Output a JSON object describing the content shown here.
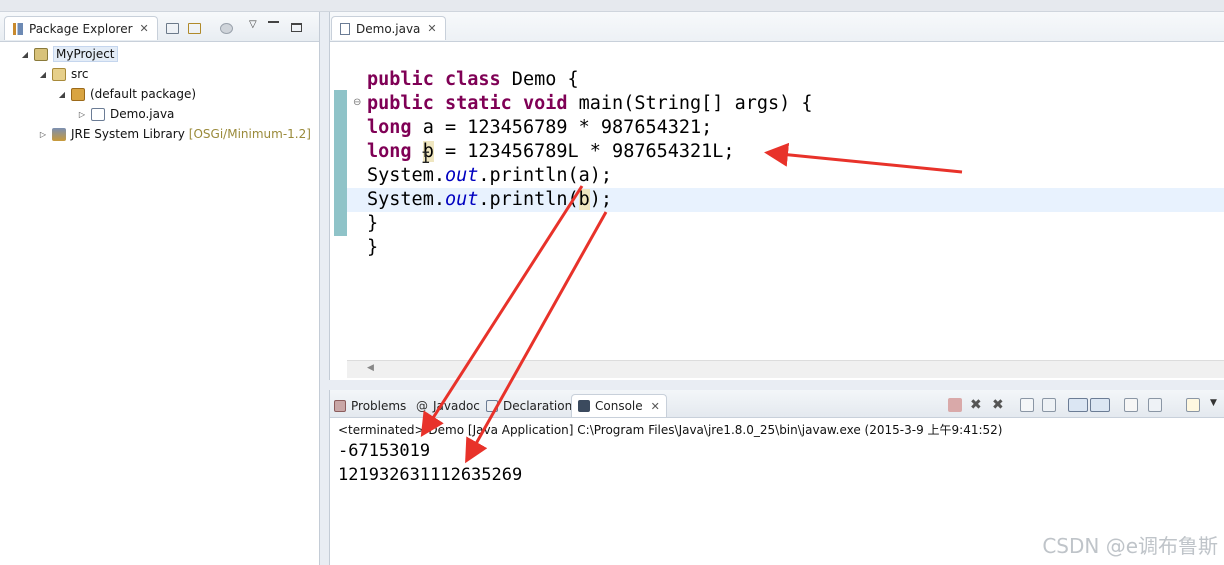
{
  "package_explorer": {
    "tab_label": "Package Explorer",
    "tree": [
      {
        "label": "MyProject"
      },
      {
        "label": "src"
      },
      {
        "label": "(default package)"
      },
      {
        "label": "Demo.java"
      },
      {
        "label": "JRE System Library",
        "decoration": "[OSGi/Minimum-1.2]"
      }
    ]
  },
  "editor": {
    "tab_label": "Demo.java",
    "code": {
      "line1_kw1": "public",
      "line1_kw2": "class",
      "line1_rest": " Demo {",
      "line2_kw1": "public",
      "line2_kw2": "static",
      "line2_kw3": "void",
      "line2_rest": " main(String[] args) {",
      "line3_kw": "long",
      "line3_rest": " a = 123456789 * 987654321;",
      "line4_kw": "long",
      "line4_var": "b",
      "line4_rest": " = 123456789L * 987654321L;",
      "line5_pre": "System.",
      "line5_fld": "out",
      "line5_post": ".println(a);",
      "line6_pre": "System.",
      "line6_fld": "out",
      "line6_post": ".println(",
      "line6_arg": "b",
      "line6_end": ");",
      "line7": "}",
      "line8": "}"
    }
  },
  "console": {
    "tabs": {
      "problems": "Problems",
      "javadoc": "Javadoc",
      "declaration": "Declaration",
      "console": "Console"
    },
    "status": "<terminated> Demo [Java Application] C:\\Program Files\\Java\\jre1.8.0_25\\bin\\javaw.exe (2015-3-9 上午9:41:52)",
    "output": [
      "-67153019",
      "121932631112635269"
    ]
  },
  "watermark": "CSDN @e调布鲁斯",
  "colors": {
    "annotation_arrow": "#e8322a",
    "keyword": "#7f0055",
    "field": "#0000c0"
  }
}
